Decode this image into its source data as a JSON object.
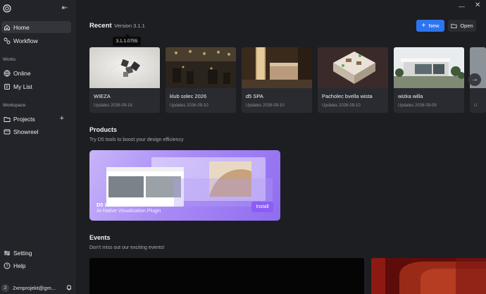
{
  "sidebar": {
    "nav": [
      {
        "label": "Home",
        "icon": "home-icon"
      },
      {
        "label": "Workflow",
        "icon": "workflow-icon"
      }
    ],
    "works_label": "Works",
    "works": [
      {
        "label": "Online",
        "icon": "globe-icon"
      },
      {
        "label": "My List",
        "icon": "list-icon"
      }
    ],
    "workspace_label": "Workspace",
    "workspace": [
      {
        "label": "Projects",
        "icon": "folder-icon"
      },
      {
        "label": "Showreel",
        "icon": "showreel-icon"
      }
    ],
    "bottom": [
      {
        "label": "Setting",
        "icon": "settings-icon"
      },
      {
        "label": "Help",
        "icon": "help-icon"
      }
    ],
    "user": {
      "avatar": "2",
      "email": "2xmprojekt@gm..."
    }
  },
  "header": {
    "title": "Recent",
    "version": "Version 3.1.1",
    "tooltip": "3.1.1.0755",
    "new_label": "New",
    "open_label": "Open"
  },
  "recent": [
    {
      "name": "WIEZA",
      "date": "Updates 2026-09-18"
    },
    {
      "name": "klub solec 2026",
      "date": "Updates 2026-09-10"
    },
    {
      "name": "d5 SPA",
      "date": "Updates 2026-09-10"
    },
    {
      "name": "Pacholec bvella wista",
      "date": "Updates 2026-09-10"
    },
    {
      "name": "wizka willa",
      "date": "Updates 2026-09-09"
    },
    {
      "name": "",
      "date": "U"
    }
  ],
  "products": {
    "title": "Products",
    "subtitle": "Try D5 tools to boost your design efficiency",
    "card_title": "D5 Lite",
    "card_subtitle": "AI-Native Visualization Plugin",
    "install_label": "Install"
  },
  "events": {
    "title": "Events",
    "subtitle": "Don't miss out our exciting events!"
  },
  "colors": {
    "accent": "#2d74f0",
    "background": "#1d1e22",
    "sidebar": "#232429",
    "install": "#8b5cf6"
  }
}
